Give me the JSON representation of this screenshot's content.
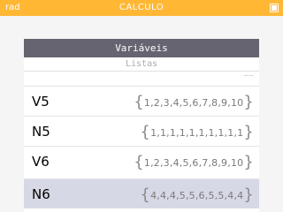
{
  "status_bar": {
    "mode": "rad",
    "title": "CALCULO"
  },
  "panel": {
    "title": "Variáveis",
    "subtitle": "Listas"
  },
  "variables": [
    {
      "name": "V5",
      "value": "1,2,3,4,5,6,7,8,9,10"
    },
    {
      "name": "N5",
      "value": "1,1,1,1,1,1,1,1,1,1"
    },
    {
      "name": "V6",
      "value": "1,2,3,4,5,6,7,8,9,10"
    },
    {
      "name": "N6",
      "value": "4,4,4,5,5,6,5,5,4,4"
    }
  ],
  "colors": {
    "status_bar": "#ffb734",
    "header": "#656470",
    "selected_row": "#d7d8e6"
  }
}
